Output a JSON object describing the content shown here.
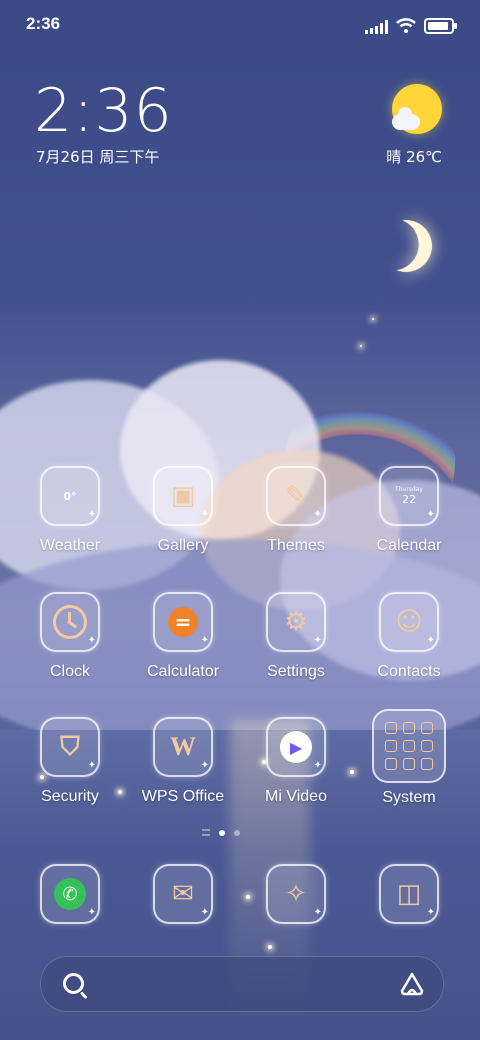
{
  "status_bar": {
    "time": "2:36",
    "battery_level": 0.9
  },
  "clock_widget": {
    "time": "2:36",
    "date": "7月26日 周三下午",
    "weather": "晴 26℃"
  },
  "apps": [
    {
      "label": "Weather",
      "icon": "weather-icon",
      "glyph": "0°"
    },
    {
      "label": "Gallery",
      "icon": "gallery-icon",
      "glyph": "▣"
    },
    {
      "label": "Themes",
      "icon": "themes-icon",
      "glyph": "✎"
    },
    {
      "label": "Calendar",
      "icon": "calendar-icon",
      "glyph_day": "Thursday",
      "glyph_date": "22"
    },
    {
      "label": "Clock",
      "icon": "clock-icon"
    },
    {
      "label": "Calculator",
      "icon": "calculator-icon",
      "glyph": "="
    },
    {
      "label": "Settings",
      "icon": "settings-icon",
      "glyph": "⚙"
    },
    {
      "label": "Contacts",
      "icon": "contacts-icon",
      "glyph": "☺"
    },
    {
      "label": "Security",
      "icon": "security-icon",
      "glyph": "⛉"
    },
    {
      "label": "WPS Office",
      "icon": "wps-office-icon",
      "glyph": "W"
    },
    {
      "label": "Mi Video",
      "icon": "mi-video-icon",
      "glyph": "▶"
    },
    {
      "label": "System",
      "icon": "system-folder-icon"
    }
  ],
  "dock": [
    {
      "icon": "phone-icon",
      "glyph": "✆"
    },
    {
      "icon": "messages-icon",
      "glyph": "✉"
    },
    {
      "icon": "browser-icon",
      "glyph": "✧"
    },
    {
      "icon": "camera-icon",
      "glyph": "◫"
    }
  ],
  "colors": {
    "accent": "#f3c9a3",
    "weather_sun": "#ffd53a",
    "calculator": "#f0832a",
    "phone": "#35c15a"
  }
}
